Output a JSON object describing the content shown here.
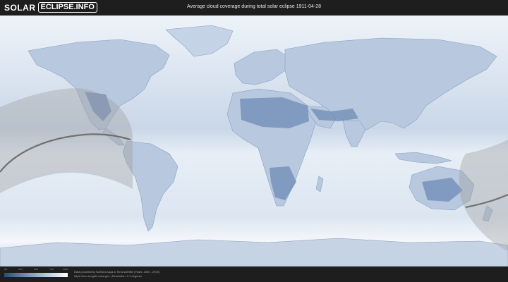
{
  "header": {
    "logo_solar": "SOLAR",
    "logo_eclipse": "ECLIPSE.INFO",
    "title": "Average cloud coverage during total solar eclipse 1911-04-28"
  },
  "legend": {
    "ticks": [
      "0%",
      "25%",
      "50%",
      "75%",
      "100%"
    ],
    "colors": [
      "#2c4a78",
      "#6f8db9",
      "#b7c9e0",
      "#ffffff"
    ]
  },
  "credits": {
    "line1": "Data provided by NASA's Aqua & Terra satellite (Years: 2000 - 2019)",
    "line2": "https://neo.sci.gsfc.nasa.gov | Resolution: 0.1 degrees"
  },
  "colors": {
    "background": "#1e1e1e",
    "ocean_clear": "#dfe8f3",
    "land_cloudy": "#7f98c0",
    "eclipse_band": "#9e9e9e",
    "central_line": "#707070"
  }
}
